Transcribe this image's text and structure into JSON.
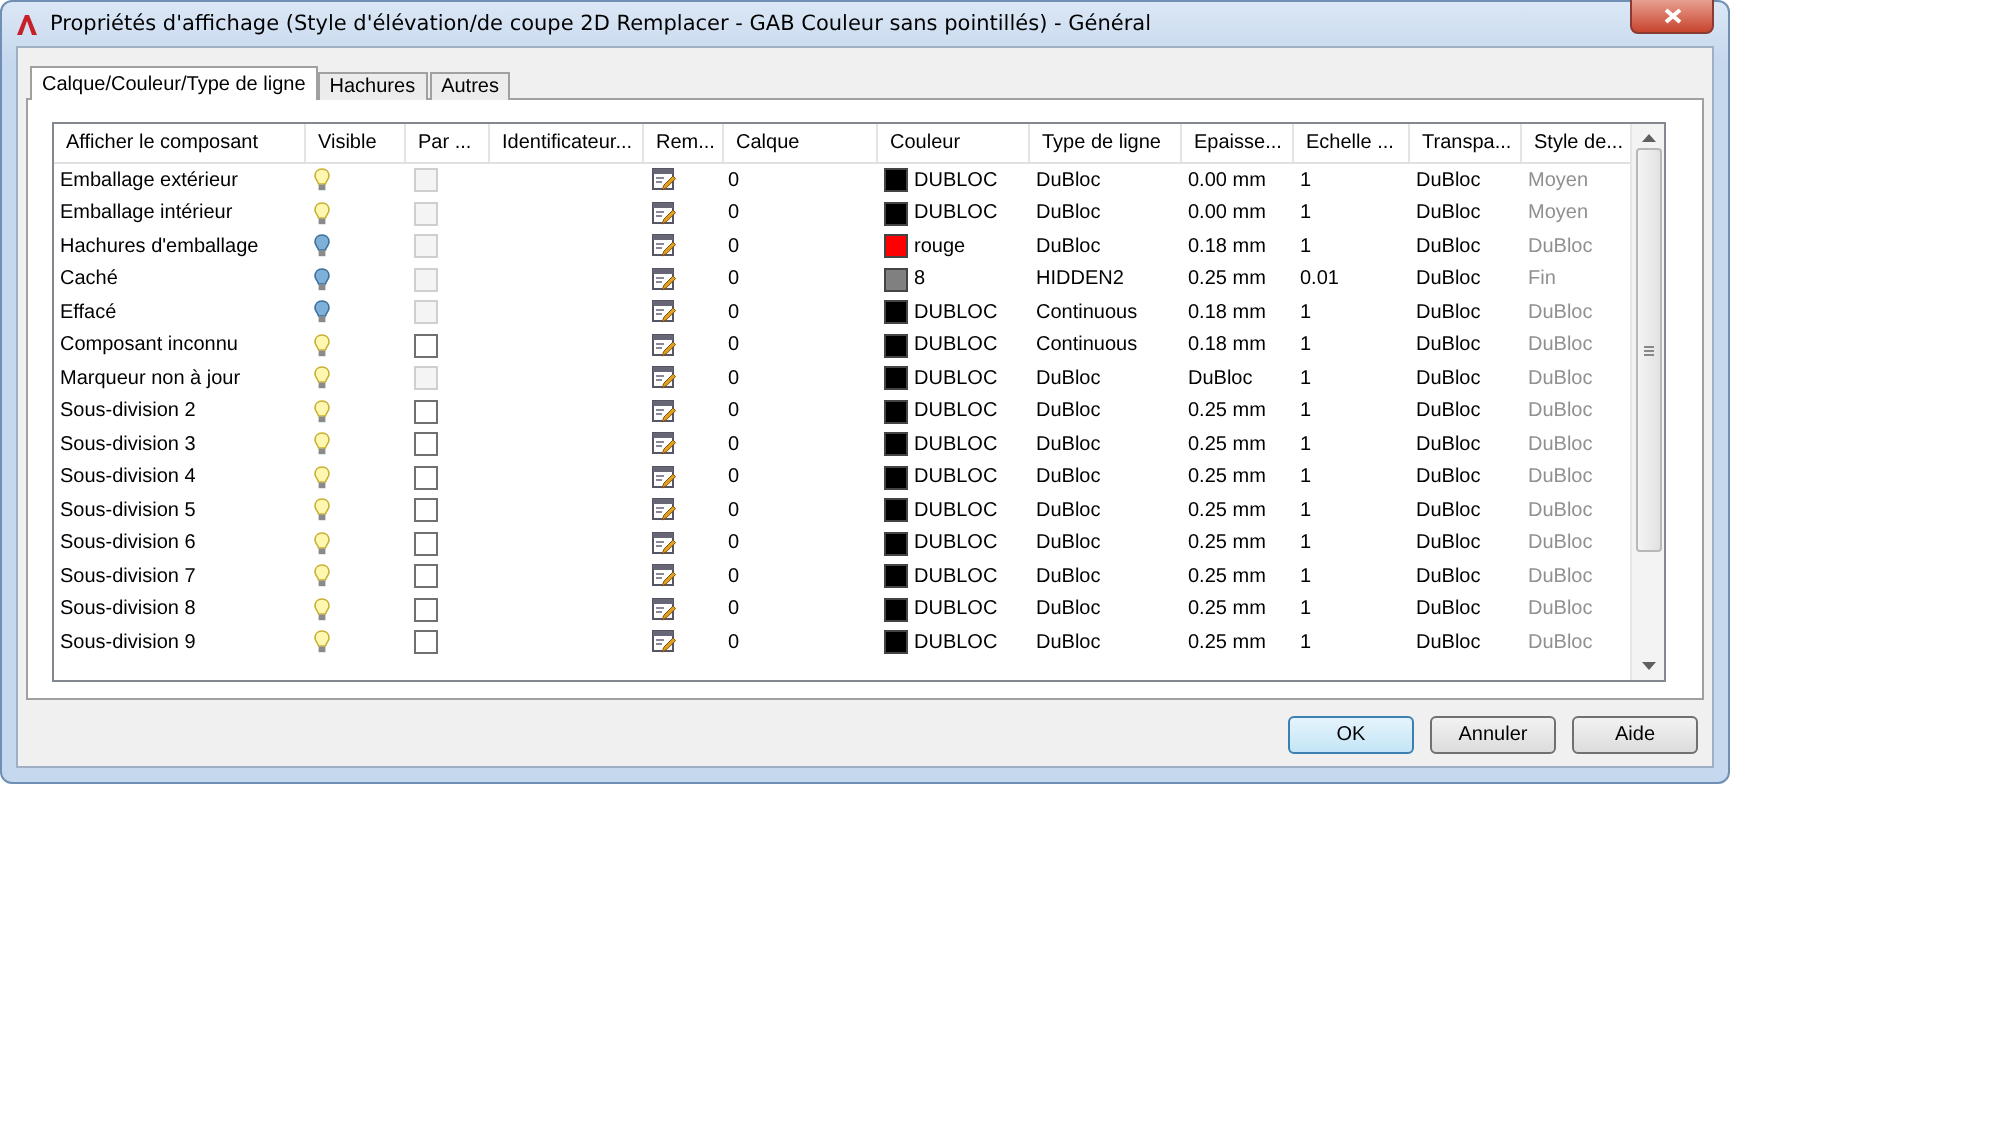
{
  "window": {
    "title": "Propriétés d'affichage (Style d'élévation/de coupe 2D Remplacer - GAB Couleur sans pointillés) - Général"
  },
  "tabs": [
    {
      "label": "Calque/Couleur/Type de ligne",
      "selected": true
    },
    {
      "label": "Hachures",
      "selected": false
    },
    {
      "label": "Autres",
      "selected": false
    }
  ],
  "table": {
    "columns": [
      "Afficher le composant",
      "Visible",
      "Par ...",
      "Identificateur...",
      "Rem...",
      "Calque",
      "Couleur",
      "Type de ligne",
      "Epaisse...",
      "Echelle ...",
      "Transpa...",
      "Style de..."
    ],
    "rows": [
      {
        "name": "Emballage extérieur",
        "visible": true,
        "par": {
          "checked": false,
          "disabled": true
        },
        "calque": "0",
        "color": "#000000",
        "couleur": "DUBLOC",
        "type": "DuBloc",
        "epaisseur": "0.00 mm",
        "echelle": "1",
        "transparence": "DuBloc",
        "style": "Moyen"
      },
      {
        "name": "Emballage intérieur",
        "visible": true,
        "par": {
          "checked": false,
          "disabled": true
        },
        "calque": "0",
        "color": "#000000",
        "couleur": "DUBLOC",
        "type": "DuBloc",
        "epaisseur": "0.00 mm",
        "echelle": "1",
        "transparence": "DuBloc",
        "style": "Moyen"
      },
      {
        "name": "Hachures d'emballage",
        "visible": false,
        "par": {
          "checked": false,
          "disabled": true
        },
        "calque": "0",
        "color": "#ff0000",
        "couleur": "rouge",
        "type": "DuBloc",
        "epaisseur": "0.18 mm",
        "echelle": "1",
        "transparence": "DuBloc",
        "style": "DuBloc"
      },
      {
        "name": "Caché",
        "visible": false,
        "par": {
          "checked": false,
          "disabled": true
        },
        "calque": "0",
        "color": "#808080",
        "couleur": "8",
        "type": "HIDDEN2",
        "epaisseur": "0.25 mm",
        "echelle": "0.01",
        "transparence": "DuBloc",
        "style": "Fin"
      },
      {
        "name": "Effacé",
        "visible": false,
        "par": {
          "checked": false,
          "disabled": true
        },
        "calque": "0",
        "color": "#000000",
        "couleur": "DUBLOC",
        "type": "Continuous",
        "epaisseur": "0.18 mm",
        "echelle": "1",
        "transparence": "DuBloc",
        "style": "DuBloc"
      },
      {
        "name": "Composant inconnu",
        "visible": true,
        "par": {
          "checked": false,
          "disabled": false
        },
        "calque": "0",
        "color": "#000000",
        "couleur": "DUBLOC",
        "type": "Continuous",
        "epaisseur": "0.18 mm",
        "echelle": "1",
        "transparence": "DuBloc",
        "style": "DuBloc"
      },
      {
        "name": "Marqueur non à jour",
        "visible": true,
        "par": {
          "checked": false,
          "disabled": true
        },
        "calque": "0",
        "color": "#000000",
        "couleur": "DUBLOC",
        "type": "DuBloc",
        "epaisseur": "DuBloc",
        "echelle": "1",
        "transparence": "DuBloc",
        "style": "DuBloc"
      },
      {
        "name": "Sous-division 2",
        "visible": true,
        "par": {
          "checked": false,
          "disabled": false
        },
        "calque": "0",
        "color": "#000000",
        "couleur": "DUBLOC",
        "type": "DuBloc",
        "epaisseur": "0.25 mm",
        "echelle": "1",
        "transparence": "DuBloc",
        "style": "DuBloc"
      },
      {
        "name": "Sous-division 3",
        "visible": true,
        "par": {
          "checked": false,
          "disabled": false
        },
        "calque": "0",
        "color": "#000000",
        "couleur": "DUBLOC",
        "type": "DuBloc",
        "epaisseur": "0.25 mm",
        "echelle": "1",
        "transparence": "DuBloc",
        "style": "DuBloc"
      },
      {
        "name": "Sous-division 4",
        "visible": true,
        "par": {
          "checked": false,
          "disabled": false
        },
        "calque": "0",
        "color": "#000000",
        "couleur": "DUBLOC",
        "type": "DuBloc",
        "epaisseur": "0.25 mm",
        "echelle": "1",
        "transparence": "DuBloc",
        "style": "DuBloc"
      },
      {
        "name": "Sous-division 5",
        "visible": true,
        "par": {
          "checked": false,
          "disabled": false
        },
        "calque": "0",
        "color": "#000000",
        "couleur": "DUBLOC",
        "type": "DuBloc",
        "epaisseur": "0.25 mm",
        "echelle": "1",
        "transparence": "DuBloc",
        "style": "DuBloc"
      },
      {
        "name": "Sous-division 6",
        "visible": true,
        "par": {
          "checked": false,
          "disabled": false
        },
        "calque": "0",
        "color": "#000000",
        "couleur": "DUBLOC",
        "type": "DuBloc",
        "epaisseur": "0.25 mm",
        "echelle": "1",
        "transparence": "DuBloc",
        "style": "DuBloc"
      },
      {
        "name": "Sous-division 7",
        "visible": true,
        "par": {
          "checked": false,
          "disabled": false
        },
        "calque": "0",
        "color": "#000000",
        "couleur": "DUBLOC",
        "type": "DuBloc",
        "epaisseur": "0.25 mm",
        "echelle": "1",
        "transparence": "DuBloc",
        "style": "DuBloc"
      },
      {
        "name": "Sous-division 8",
        "visible": true,
        "par": {
          "checked": false,
          "disabled": false
        },
        "calque": "0",
        "color": "#000000",
        "couleur": "DUBLOC",
        "type": "DuBloc",
        "epaisseur": "0.25 mm",
        "echelle": "1",
        "transparence": "DuBloc",
        "style": "DuBloc"
      },
      {
        "name": "Sous-division 9",
        "visible": true,
        "par": {
          "checked": false,
          "disabled": false
        },
        "calque": "0",
        "color": "#000000",
        "couleur": "DUBLOC",
        "type": "DuBloc",
        "epaisseur": "0.25 mm",
        "echelle": "1",
        "transparence": "DuBloc",
        "style": "DuBloc"
      }
    ]
  },
  "buttons": [
    {
      "label": "OK",
      "default": true
    },
    {
      "label": "Annuler",
      "default": false
    },
    {
      "label": "Aide",
      "default": false
    }
  ]
}
